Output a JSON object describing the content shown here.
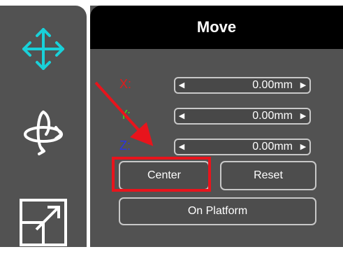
{
  "panel": {
    "title": "Move"
  },
  "toolbar": {
    "tools": [
      {
        "icon": "move-icon"
      },
      {
        "icon": "rotate-icon"
      },
      {
        "icon": "scale-icon"
      }
    ]
  },
  "axes": [
    {
      "label": "X:",
      "value": "0.00mm",
      "color": "#e01b1b"
    },
    {
      "label": "Y:",
      "value": "0.00mm",
      "color": "#3ad61a"
    },
    {
      "label": "Z:",
      "value": "0.00mm",
      "color": "#2a34e6"
    }
  ],
  "buttons": {
    "center": "Center",
    "reset": "Reset",
    "on_platform": "On Platform"
  },
  "colors": {
    "accent": "#19d1d9",
    "annotation": "#e8141c"
  }
}
